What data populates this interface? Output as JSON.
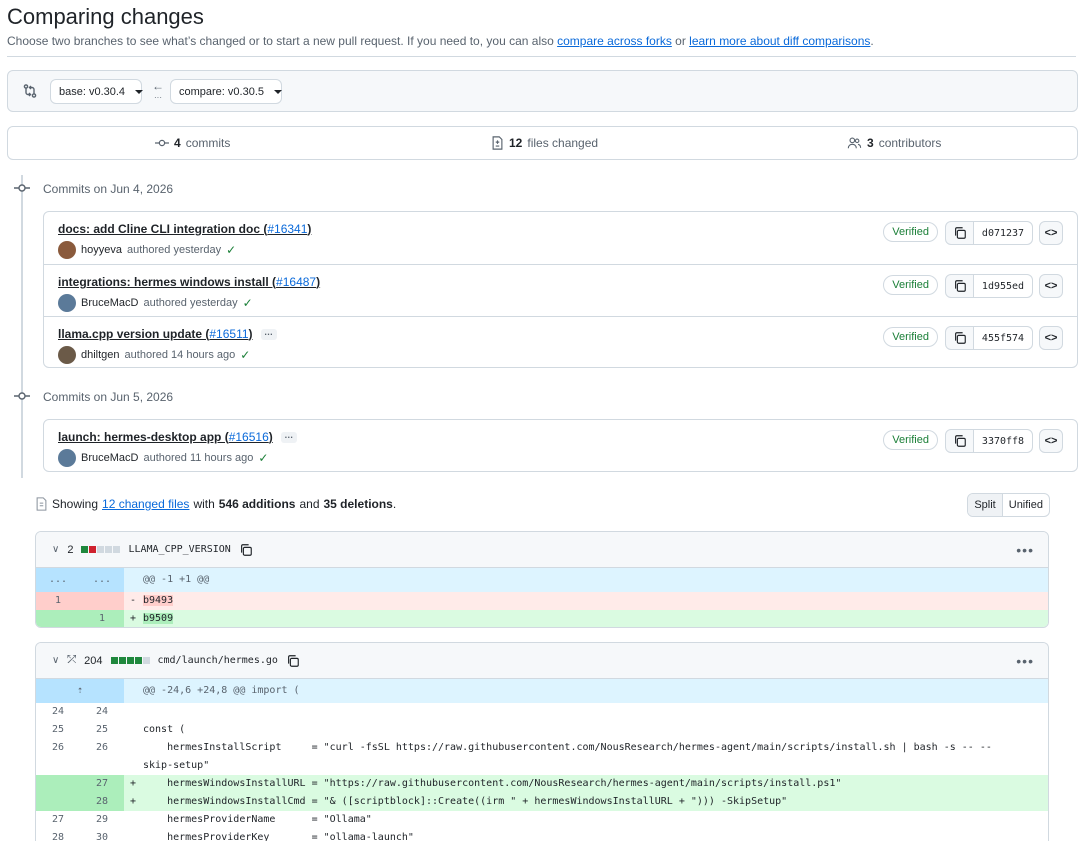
{
  "header": {
    "title": "Comparing changes",
    "subtitle_before": "Choose two branches to see what’s changed or to start a new pull request. If you need to, you can also ",
    "link_forks": "compare across forks",
    "subtitle_or": " or ",
    "link_learn": "learn more about diff comparisons",
    "subtitle_end": "."
  },
  "range": {
    "base_label": "base: v0.30.4",
    "compare_label": "compare: v0.30.5",
    "arrow": "←",
    "arrow_dots": "···"
  },
  "summary": {
    "commits_count": "4",
    "commits_label": "commits",
    "files_count": "12",
    "files_label": "files changed",
    "contributors_count": "3",
    "contributors_label": "contributors"
  },
  "commit_groups": [
    {
      "heading": "Commits on Jun 4, 2026",
      "commits": [
        {
          "title": "docs: add Cline CLI integration doc (",
          "pr": "#16341",
          "close": ")",
          "author": "hoyyeva",
          "time": "authored yesterday",
          "verified": "Verified",
          "sha": "d071237",
          "avatar_color": "#8a5a3c",
          "has_more": false
        },
        {
          "title": "integrations: hermes windows install (",
          "pr": "#16487",
          "close": ")",
          "author": "BruceMacD",
          "time": "authored yesterday",
          "verified": "Verified",
          "sha": "1d955ed",
          "avatar_color": "#5b7a99",
          "has_more": false
        },
        {
          "title": "llama.cpp version update (",
          "pr": "#16511",
          "close": ")",
          "author": "dhiltgen",
          "time": "authored 14 hours ago",
          "verified": "Verified",
          "sha": "455f574",
          "avatar_color": "#6b5a48",
          "has_more": true
        }
      ]
    },
    {
      "heading": "Commits on Jun 5, 2026",
      "commits": [
        {
          "title": "launch: hermes-desktop app (",
          "pr": "#16516",
          "close": ")",
          "author": "BruceMacD",
          "time": "authored 11 hours ago",
          "verified": "Verified",
          "sha": "3370ff8",
          "avatar_color": "#5b7a99",
          "has_more": true
        }
      ]
    }
  ],
  "files_summary": {
    "showing": "Showing",
    "changed_files": "12 changed files",
    "with": "with",
    "additions": "546 additions",
    "and": "and",
    "deletions": "35 deletions",
    "end": "."
  },
  "view_toggle": {
    "split": "Split",
    "unified": "Unified"
  },
  "diffs": [
    {
      "count": "2",
      "filename": "LLAMA_CPP_VERSION",
      "hunk_l": "...",
      "hunk_r": "...",
      "hunk": "@@ -1 +1 @@",
      "del_ln": "1",
      "del_line": "b9493",
      "add_ln": "1",
      "add_line": "b9509"
    },
    {
      "count": "204",
      "filename": "cmd/launch/hermes.go",
      "hunk": "@@ -24,6 +24,8 @@ import (",
      "lines": [
        {
          "type": "ctx",
          "l": "24",
          "r": "24",
          "text": ""
        },
        {
          "type": "ctx",
          "l": "25",
          "r": "25",
          "text": "const ("
        },
        {
          "type": "ctx",
          "l": "26",
          "r": "26",
          "text": "    hermesInstallScript     = \"curl -fsSL https://raw.githubusercontent.com/NousResearch/hermes-agent/main/scripts/install.sh | bash -s -- --"
        },
        {
          "type": "ctx",
          "l": "",
          "r": "",
          "text": "skip-setup\""
        },
        {
          "type": "add",
          "l": "",
          "r": "27",
          "text": "    hermesWindowsInstallURL = \"https://raw.githubusercontent.com/NousResearch/hermes-agent/main/scripts/install.ps1\""
        },
        {
          "type": "add",
          "l": "",
          "r": "28",
          "text": "    hermesWindowsInstallCmd = \"& ([scriptblock]::Create((irm \" + hermesWindowsInstallURL + \"))) -SkipSetup\""
        },
        {
          "type": "ctx",
          "l": "27",
          "r": "29",
          "text": "    hermesProviderName      = \"Ollama\""
        },
        {
          "type": "ctx",
          "l": "28",
          "r": "30",
          "text": "    hermesProviderKey       = \"ollama-launch\""
        }
      ]
    }
  ],
  "colors": {
    "link": "#0969da",
    "verified": "#1a7f37",
    "addition": "#1f883d",
    "deletion": "#cf222e"
  }
}
